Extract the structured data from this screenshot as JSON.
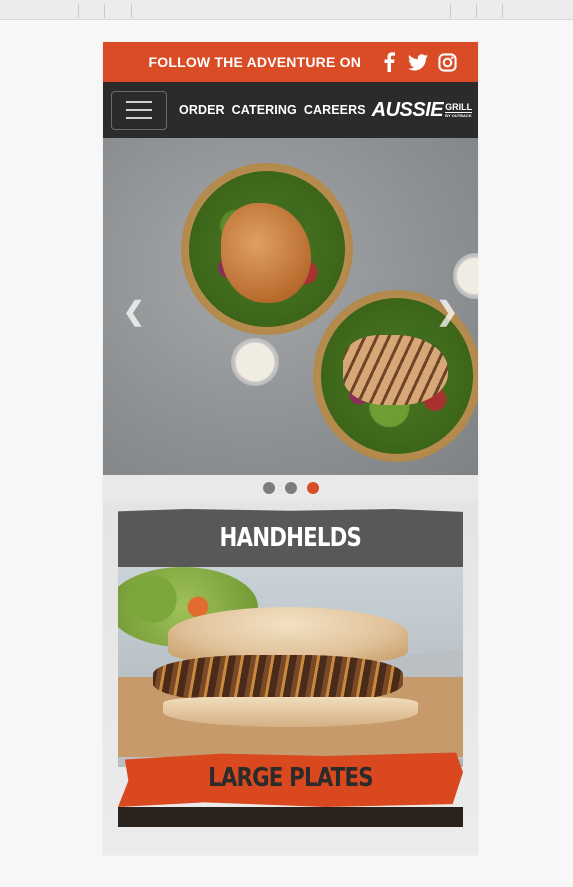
{
  "follow_bar": {
    "text": "FOLLOW THE ADVENTURE ON",
    "icons": [
      "facebook-icon",
      "twitter-icon",
      "instagram-icon"
    ],
    "color": "#d94c26"
  },
  "nav": {
    "links": [
      "ORDER",
      "CATERING",
      "CAREERS"
    ],
    "logo_main": "AUSSIE",
    "logo_grill": "GRILL",
    "logo_by": "BY OUTBACK",
    "background": "#2b2b2b"
  },
  "carousel": {
    "slide_count": 3,
    "active_index": 2,
    "prev_icon": "chevron-left-icon",
    "next_icon": "chevron-right-icon"
  },
  "sections": {
    "handhelds": "HANDHELDS",
    "large_plates": "LARGE PLATES"
  }
}
